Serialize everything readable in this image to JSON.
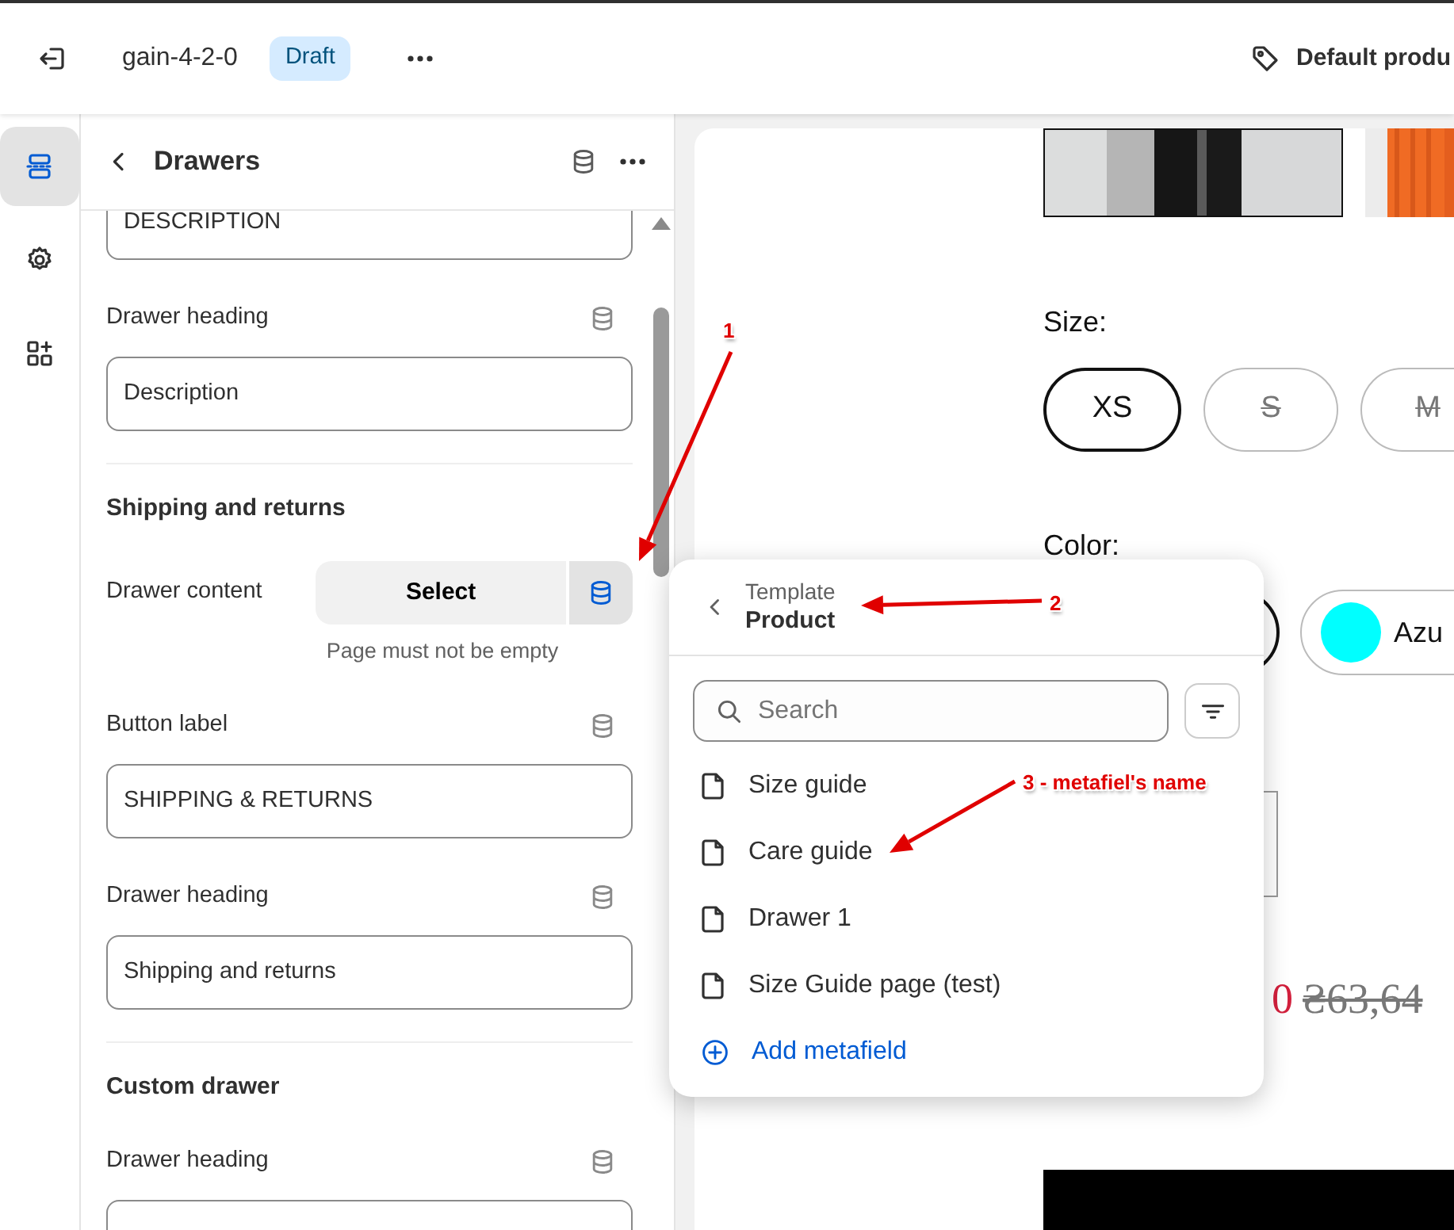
{
  "top_bar": {
    "project": "gain-4-2-0",
    "status_badge": "Draft",
    "template": "Default produ"
  },
  "rail": [
    {
      "kind": "sections",
      "selected": true
    },
    {
      "kind": "settings",
      "selected": false
    },
    {
      "kind": "apps",
      "selected": false
    }
  ],
  "panel": {
    "title": "Drawers",
    "items": [
      {
        "kind": "input",
        "value": "DESCRIPTION"
      },
      {
        "kind": "input",
        "label": "Drawer heading",
        "value": "Description"
      },
      {
        "kind": "divider"
      },
      {
        "kind": "heading",
        "text": "Shipping and returns"
      },
      {
        "kind": "picker",
        "label": "Drawer content",
        "button": "Select",
        "source_active": true,
        "help": "Page must not be empty"
      },
      {
        "kind": "input",
        "label": "Button label",
        "value": "SHIPPING & RETURNS"
      },
      {
        "kind": "input",
        "label": "Drawer heading",
        "value": "Shipping and returns"
      },
      {
        "kind": "divider"
      },
      {
        "kind": "heading",
        "text": "Custom drawer"
      },
      {
        "kind": "input",
        "label": "Drawer heading"
      }
    ]
  },
  "preview": {
    "size_label": "Size:",
    "sizes": [
      {
        "label": "XS",
        "selected": true,
        "available": true
      },
      {
        "label": "S",
        "selected": false,
        "available": false
      },
      {
        "label": "M",
        "selected": false,
        "available": false
      }
    ],
    "color_label": "Color:",
    "colors": [
      {
        "selected": true
      },
      {
        "label": "Azu",
        "color": "#00ffff",
        "selected": false
      }
    ],
    "sale_price": "0",
    "compare_price": "₴63,64"
  },
  "popover": {
    "context_label": "Template",
    "context": "Product",
    "search": {
      "placeholder": "Search"
    },
    "items": [
      "Size guide",
      "Care guide",
      "Drawer 1",
      "Size Guide page (test)"
    ],
    "add_link": "Add metafield"
  },
  "annotations": [
    {
      "text": "1"
    },
    {
      "text": "2"
    },
    {
      "text": "3 - metafiel's name"
    }
  ]
}
